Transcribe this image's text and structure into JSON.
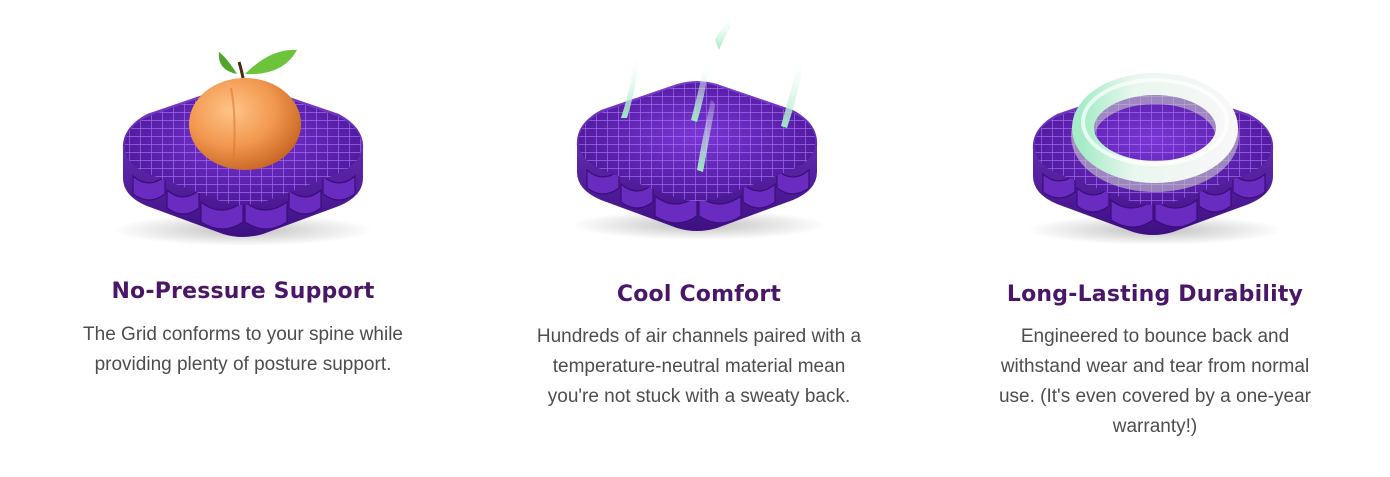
{
  "features": [
    {
      "title": "No-Pressure Support",
      "description": "The Grid conforms to your spine while providing plenty of posture support.",
      "icon": "peach-on-grid-icon"
    },
    {
      "title": "Cool Comfort",
      "description": "Hundreds of air channels paired with a temperature-neutral material mean you're not stuck with a sweaty back.",
      "icon": "airflow-grid-icon"
    },
    {
      "title": "Long-Lasting Durability",
      "description": "Engineered to bounce back and withstand wear and tear from normal use. (It's even covered by a one-year warranty!)",
      "icon": "ring-on-grid-icon"
    }
  ],
  "colors": {
    "title": "#4a1768",
    "body_text": "#4d4d4d",
    "grid_purple": "#5b1fa6",
    "grid_purple_light": "#8a4fd8",
    "peach": "#f09a55",
    "leaf": "#6cc43a",
    "mint": "#a6ecc8",
    "ring_white": "#f4f4f4"
  }
}
